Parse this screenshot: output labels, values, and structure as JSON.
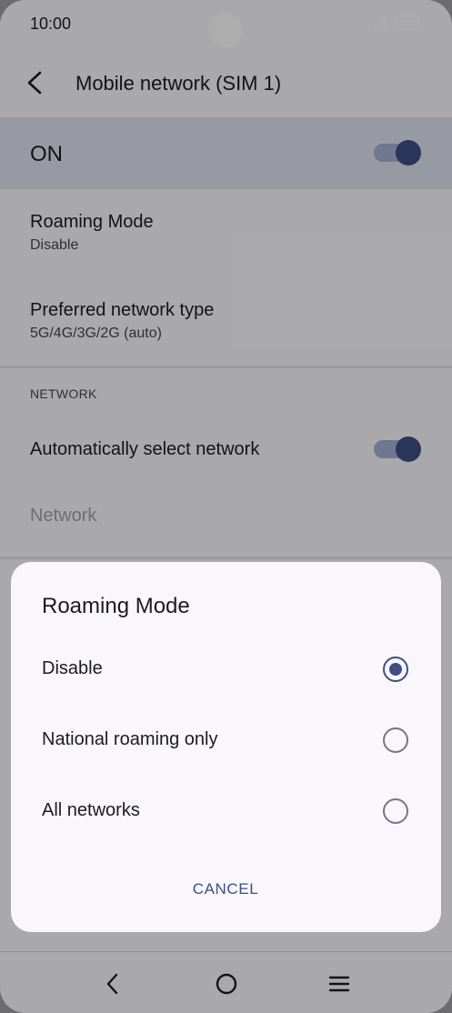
{
  "status_bar": {
    "time": "10:00",
    "battery_label": "100",
    "icons": [
      "signal-icon",
      "battery-icon"
    ]
  },
  "app_bar": {
    "title": "Mobile network (SIM 1)",
    "back_icon": "back-arrow-icon"
  },
  "main_switch": {
    "label": "ON",
    "checked": true
  },
  "settings": {
    "roaming_mode": {
      "title": "Roaming Mode",
      "value": "Disable"
    },
    "preferred_network": {
      "title": "Preferred network type",
      "value": "5G/4G/3G/2G (auto)"
    },
    "section_network": "NETWORK",
    "auto_select": {
      "title": "Automatically select network",
      "checked": true
    },
    "network": {
      "title": "Network"
    }
  },
  "dialog": {
    "title": "Roaming Mode",
    "options": [
      {
        "label": "Disable",
        "selected": true
      },
      {
        "label": "National roaming only",
        "selected": false
      },
      {
        "label": "All networks",
        "selected": false
      }
    ],
    "cancel_label": "CANCEL"
  },
  "nav_bar": {
    "icons": [
      "nav-back-icon",
      "nav-home-icon",
      "nav-menu-icon"
    ]
  },
  "colors": {
    "accent": "#3e4f85",
    "switch_track": "#a5b0d6",
    "highlight_row": "#dfe2f0",
    "scrim": "rgba(0,0,0,0.32)"
  }
}
